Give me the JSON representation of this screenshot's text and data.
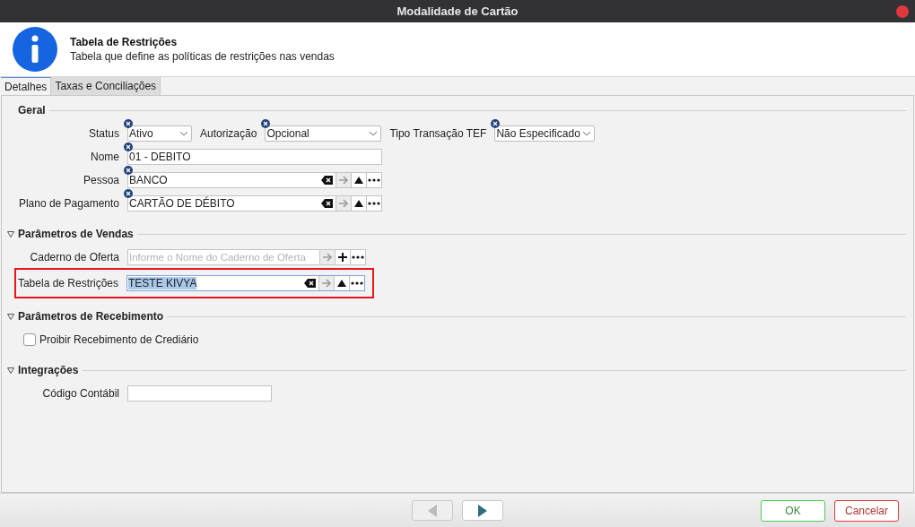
{
  "window": {
    "title": "Modalidade de Cartão"
  },
  "header": {
    "title": "Tabela de Restrições",
    "description": "Tabela que define as políticas de restrições nas vendas"
  },
  "tabs": [
    {
      "label": "Detalhes",
      "selected": true
    },
    {
      "label": "Taxas e Conciliações",
      "selected": false
    }
  ],
  "sections": [
    {
      "title": "Geral",
      "collapsible": false,
      "rows": [
        {
          "highlighted": false,
          "fields": [
            {
              "kind": "select",
              "label": "Status",
              "value": "Ativo",
              "required": true
            },
            {
              "kind": "select",
              "label": "Autorização",
              "value": "Opcional",
              "required": true
            },
            {
              "kind": "select",
              "label": "Tipo Transação TEF",
              "value": "Não Especificado",
              "required": true
            }
          ]
        },
        {
          "highlighted": false,
          "fields": [
            {
              "kind": "text",
              "label": "Nome",
              "value": "01 - DEBITO",
              "required": true
            }
          ]
        },
        {
          "highlighted": false,
          "fields": [
            {
              "kind": "lookup",
              "label": "Pessoa",
              "value": "BANCO",
              "required": true,
              "value_selected": false
            }
          ]
        },
        {
          "highlighted": false,
          "fields": [
            {
              "kind": "lookup",
              "label": "Plano de Pagamento",
              "value": "CARTÃO DE DÉBITO",
              "required": true,
              "value_selected": false
            }
          ]
        }
      ]
    },
    {
      "title": "Parâmetros de Vendas",
      "collapsible": true,
      "rows": [
        {
          "highlighted": false,
          "fields": [
            {
              "kind": "lookup",
              "label": "Caderno de Oferta",
              "placeholder": "Informe o Nome do Caderno de Oferta",
              "required": false,
              "value_selected": false
            }
          ]
        },
        {
          "highlighted": true,
          "fields": [
            {
              "kind": "lookup",
              "label": "Tabela de Restrições",
              "value": "TESTE KIVYA",
              "required": false,
              "value_selected": true
            }
          ]
        }
      ]
    },
    {
      "title": "Parâmetros de Recebimento",
      "collapsible": true,
      "rows": [
        {
          "highlighted": false,
          "fields": [
            {
              "kind": "checkbox",
              "label": "Proibir Recebimento de Crediário",
              "checked": false
            }
          ]
        }
      ]
    },
    {
      "title": "Integrações",
      "collapsible": true,
      "rows": [
        {
          "highlighted": false,
          "fields": [
            {
              "kind": "text",
              "label": "Código Contábil",
              "required": false
            }
          ]
        }
      ]
    }
  ],
  "footer": {
    "previous_disabled": true,
    "next_disabled": false,
    "buttons": [
      {
        "label": "OK",
        "kind": "confirm"
      },
      {
        "label": "Cancelar",
        "kind": "cancel"
      }
    ]
  }
}
